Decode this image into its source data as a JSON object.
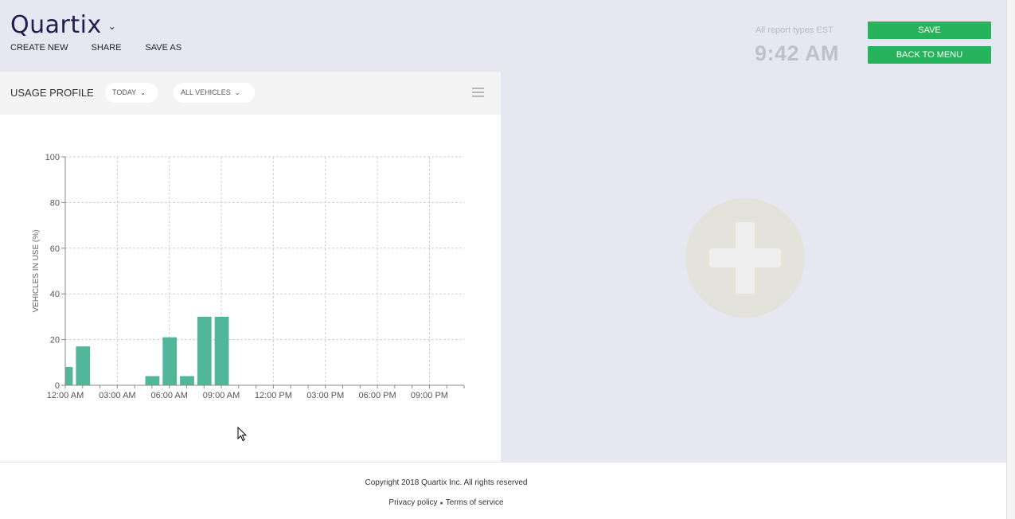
{
  "header": {
    "brand": "Quartix",
    "brand_caret": "⌄",
    "menu": [
      "CREATE NEW",
      "SHARE",
      "SAVE AS"
    ],
    "timezone_note": "All report types EST",
    "clock": "9:42 AM",
    "save_label": "SAVE",
    "back_label": "BACK TO MENU"
  },
  "panel": {
    "title": "USAGE PROFILE",
    "period_filter": "TODAY",
    "vehicle_filter": "ALL VEHICLES",
    "chevron": "❯",
    "menu_icon": "hamburger-icon"
  },
  "chart_data": {
    "type": "bar",
    "ylabel": "VEHICLES IN USE (%)",
    "xlabel": "",
    "ylim": [
      0,
      100
    ],
    "yticks": [
      0,
      20,
      40,
      60,
      80,
      100
    ],
    "xticks": [
      "12:00 AM",
      "03:00 AM",
      "06:00 AM",
      "09:00 AM",
      "12:00 PM",
      "03:00 PM",
      "06:00 PM",
      "09:00 PM"
    ],
    "xticks_hours": [
      0,
      3,
      6,
      9,
      12,
      15,
      18,
      21
    ],
    "xlim_hours": [
      0,
      23
    ],
    "bar_hours": [
      0,
      1,
      2,
      3,
      4,
      5,
      6,
      7,
      8,
      9,
      10,
      11,
      12,
      13,
      14,
      15,
      16,
      17,
      18,
      19,
      20,
      21,
      22
    ],
    "values": [
      8,
      17,
      0,
      0,
      0,
      4,
      21,
      4,
      30,
      30,
      0,
      0,
      0,
      0,
      0,
      0,
      0,
      0,
      0,
      0,
      0,
      0,
      0
    ],
    "bar_color": "#52b69a",
    "grid": true
  },
  "add_widget": {
    "icon": "plus-icon"
  },
  "footer": {
    "copyright": "Copyright 2018 Quartix Inc. All rights reserved",
    "privacy": "Privacy policy",
    "separator": "●",
    "terms": "Terms of service"
  }
}
